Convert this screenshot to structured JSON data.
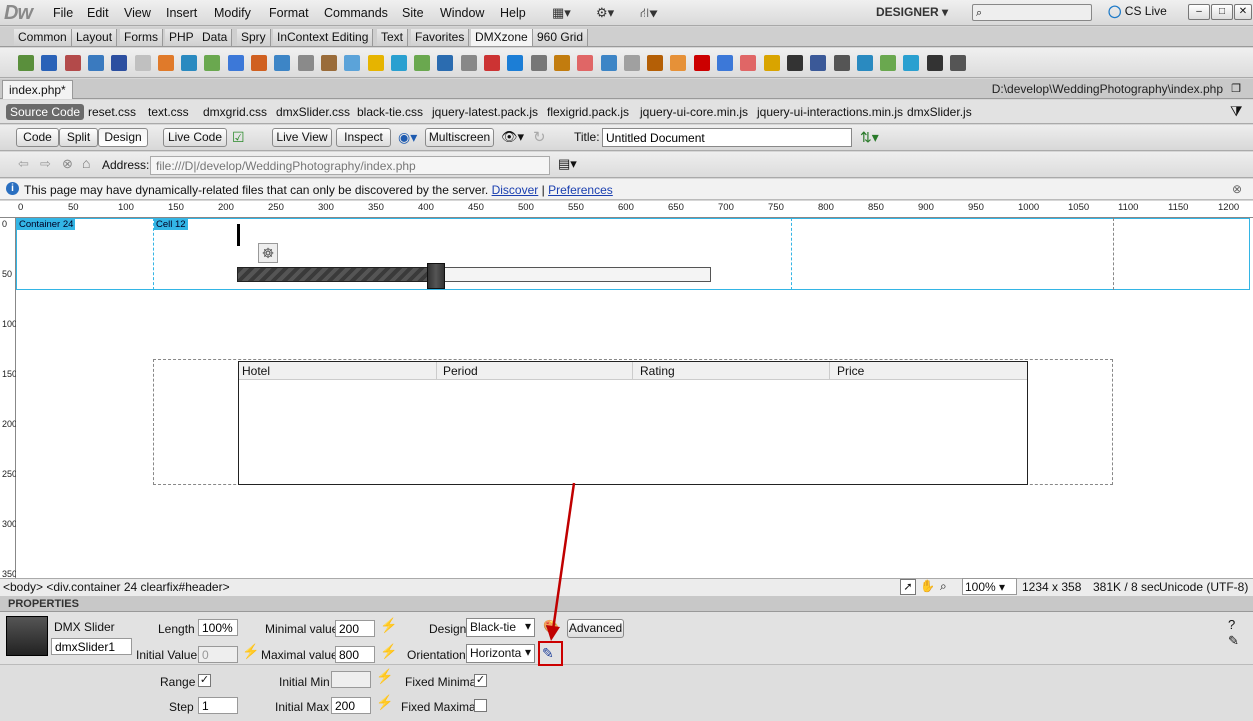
{
  "app": {
    "logo": "Dw",
    "workspace": "DESIGNER",
    "cs_live": "CS Live"
  },
  "menu": [
    "File",
    "Edit",
    "View",
    "Insert",
    "Modify",
    "Format",
    "Commands",
    "Site",
    "Window",
    "Help"
  ],
  "insert_tabs": [
    "Common",
    "Layout",
    "Forms",
    "PHP",
    "Data",
    "Spry",
    "InContext Editing",
    "Text",
    "Favorites",
    "DMXzone",
    "960 Grid"
  ],
  "active_insert_tab": "DMXzone",
  "document": {
    "tab": "index.php*",
    "path": "D:\\develop\\WeddingPhotography\\index.php"
  },
  "related_files": {
    "source": "Source Code",
    "files": [
      "reset.css",
      "text.css",
      "dmxgrid.css",
      "dmxSlider.css",
      "black-tie.css",
      "jquery-latest.pack.js",
      "flexigrid.pack.js",
      "jquery-ui-core.min.js",
      "jquery-ui-interactions.min.js",
      "dmxSlider.js"
    ]
  },
  "doc_toolbar": {
    "code": "Code",
    "split": "Split",
    "design": "Design",
    "live_code": "Live Code",
    "live_view": "Live View",
    "inspect": "Inspect",
    "multiscreen": "Multiscreen",
    "title_label": "Title:",
    "title_value": "Untitled Document"
  },
  "address": {
    "label": "Address:",
    "value": "file:///D|/develop/WeddingPhotography/index.php"
  },
  "info": {
    "text": "This page may have dynamically-related files that can only be discovered by the server.",
    "discover": "Discover",
    "preferences": "Preferences"
  },
  "ruler": [
    "0",
    "50",
    "100",
    "150",
    "200",
    "250",
    "300",
    "350",
    "400",
    "450",
    "500",
    "550",
    "600",
    "650",
    "700",
    "750",
    "800",
    "850",
    "900",
    "950",
    "1000",
    "1050",
    "1100",
    "1150",
    "1200"
  ],
  "vruler": [
    "0",
    "50",
    "100",
    "150",
    "200",
    "250",
    "300",
    "350"
  ],
  "canvas": {
    "container_label": "Container 24",
    "cell_label": "Cell 12",
    "slider_fill_fraction": 0.42,
    "table_headers": [
      "Hotel",
      "Period",
      "Rating",
      "Price"
    ]
  },
  "status": {
    "tags": "<body> <div.container  24 clearfix#header>",
    "zoom": "100%",
    "size": "1234 x 358",
    "weight": "381K / 8 sec",
    "encoding": "Unicode (UTF-8)"
  },
  "properties": {
    "panel_title": "PROPERTIES",
    "component": "DMX Slider",
    "name": "dmxSlider1",
    "length_label": "Length",
    "length": "100%",
    "initial_value_label": "Initial Value",
    "initial_value": "0",
    "min_label": "Minimal value",
    "min": "200",
    "max_label": "Maximal value",
    "max": "800",
    "design_label": "Design",
    "design": "Black-tie",
    "orientation_label": "Orientation",
    "orientation": "Horizonta",
    "advanced": "Advanced",
    "range_label": "Range",
    "initial_min_label": "Initial Min",
    "initial_min": "",
    "fixed_min_label": "Fixed Minimal",
    "step_label": "Step",
    "step": "1",
    "initial_max_label": "Initial Max",
    "initial_max": "200",
    "fixed_max_label": "Fixed Maximal"
  },
  "colors": {
    "guide": "#33b5e5",
    "annotation": "#c00000"
  }
}
